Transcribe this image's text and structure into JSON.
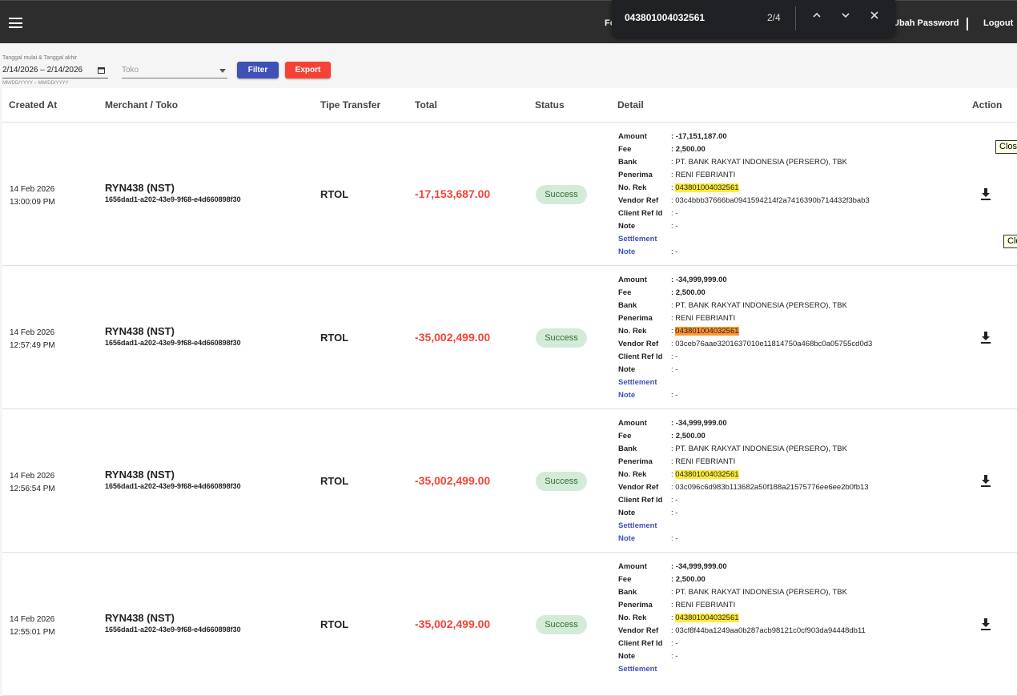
{
  "topbar": {
    "nav_fo": "Fo",
    "nav_password": "Ubah Password",
    "nav_logout": "Logout"
  },
  "findbar": {
    "query": "043801004032561",
    "count": "2/4"
  },
  "filters": {
    "date_label": "Tanggal mulai & Tanggal akhir",
    "date_value": "2/14/2026 – 2/14/2026",
    "date_hint": "MM/DD/YYYY – MM/DD/YYYY",
    "toko_placeholder": "Toko",
    "filter_label": "Filter",
    "export_label": "Export"
  },
  "table": {
    "headers": [
      "Created At",
      "Merchant / Toko",
      "Tipe Transfer",
      "Total",
      "Status",
      "Detail",
      "Action"
    ],
    "detail_keys": [
      "Amount",
      "Fee",
      "Bank",
      "Penerima",
      "No. Rek",
      "Vendor Ref",
      "Client Ref Id",
      "Note",
      "Settlement",
      "Note"
    ],
    "rows": [
      {
        "date": "14 Feb 2026",
        "time": "13:00:09 PM",
        "merchant": "RYN438 (NST)",
        "merchant_id": "1656dad1-a202-43e9-9f68-e4d660898f30",
        "tipe": "RTOL",
        "total": "-17,153,687.00",
        "status": "Success",
        "amount": ": -17,151,187.00",
        "fee": ": 2,500.00",
        "bank": ": PT. BANK RAKYAT INDONESIA (PERSERO), TBK",
        "penerima": ": RENI FEBRIANTI",
        "norek_prefix": ": ",
        "norek": "043801004032561",
        "vendor_ref": ": 03c4bbb37666ba0941594214f2a7416390b714432f3bab3",
        "client_ref": ": -",
        "note": ": -",
        "settlement_note": ": -"
      },
      {
        "date": "14 Feb 2026",
        "time": "12:57:49 PM",
        "merchant": "RYN438 (NST)",
        "merchant_id": "1656dad1-a202-43e9-9f68-e4d660898f30",
        "tipe": "RTOL",
        "total": "-35,002,499.00",
        "status": "Success",
        "amount": ": -34,999,999.00",
        "fee": ": 2,500.00",
        "bank": ": PT. BANK RAKYAT INDONESIA (PERSERO), TBK",
        "penerima": ": RENI FEBRIANTI",
        "norek_prefix": ": ",
        "norek": "043801004032561",
        "vendor_ref": ": 03ceb76aae3201637010e11814750a468bc0a05755cd0d3",
        "client_ref": ": -",
        "note": ": -",
        "settlement_note": ": -"
      },
      {
        "date": "14 Feb 2026",
        "time": "12:56:54 PM",
        "merchant": "RYN438 (NST)",
        "merchant_id": "1656dad1-a202-43e9-9f68-e4d660898f30",
        "tipe": "RTOL",
        "total": "-35,002,499.00",
        "status": "Success",
        "amount": ": -34,999,999.00",
        "fee": ": 2,500.00",
        "bank": ": PT. BANK RAKYAT INDONESIA (PERSERO), TBK",
        "penerima": ": RENI FEBRIANTI",
        "norek_prefix": ": ",
        "norek": "043801004032561",
        "vendor_ref": ": 03c096c6d983b113682a50f188a21575776ee6ee2b0fb13",
        "client_ref": ": -",
        "note": ": -",
        "settlement_note": ": -"
      },
      {
        "date": "14 Feb 2026",
        "time": "12:55:01 PM",
        "merchant": "RYN438 (NST)",
        "merchant_id": "1656dad1-a202-43e9-9f68-e4d660898f30",
        "tipe": "RTOL",
        "total": "-35,002,499.00",
        "status": "Success",
        "amount": ": -34,999,999.00",
        "fee": ": 2,500.00",
        "bank": ": PT. BANK RAKYAT INDONESIA (PERSERO), TBK",
        "penerima": ": RENI FEBRIANTI",
        "norek_prefix": ": ",
        "norek": "043801004032561",
        "vendor_ref": ": 03cf8f44ba1249aa0b287acb98121c0cf903da94448db11",
        "client_ref": ": -",
        "note": ": -",
        "settlement_note": ": -"
      }
    ]
  },
  "tooltips": [
    "Clos",
    "Clo"
  ],
  "colors": {
    "topbar": "#2d2d2d",
    "filter_button": "#3f51b5",
    "export_button": "#f44336",
    "total_negative": "#f44336",
    "status_bg": "#d3ecd8",
    "highlight": "#ffeb3b"
  }
}
